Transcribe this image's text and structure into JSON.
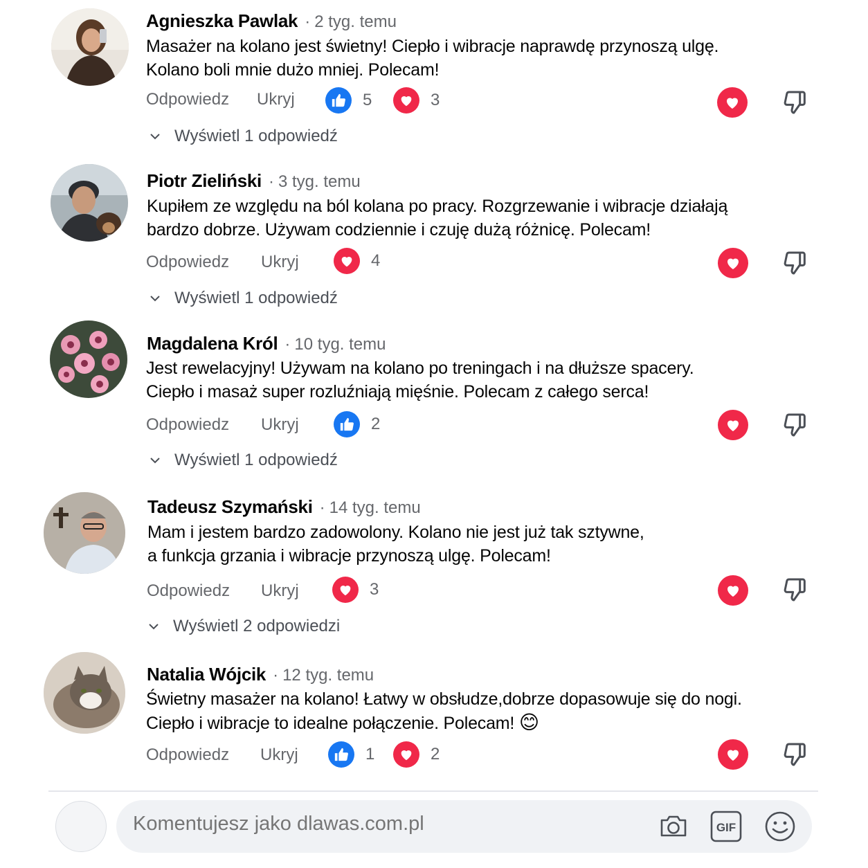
{
  "comments": [
    {
      "name": "Agnieszka Pawlak",
      "time": "2 tyg. temu",
      "line1": "Masażer na kolano jest świetny! Ciepło i wibracje naprawdę przynoszą ulgę.",
      "line2": "Kolano boli mnie dużo mniej. Polecam!",
      "reply_label": "Odpowiedz",
      "hide_label": "Ukryj",
      "like_count": "5",
      "love_count": "3",
      "view_replies": "Wyświetl 1 odpowiedź"
    },
    {
      "name": "Piotr Zieliński",
      "time": "3 tyg. temu",
      "line1": "Kupiłem ze względu na ból kolana po pracy. Rozgrzewanie i wibracje działają",
      "line2": "bardzo dobrze. Używam codziennie i czuję dużą różnicę. Polecam!",
      "reply_label": "Odpowiedz",
      "hide_label": "Ukryj",
      "love_count": "4",
      "view_replies": "Wyświetl 1 odpowiedź"
    },
    {
      "name": "Magdalena Król",
      "time": "10 tyg. temu",
      "line1": "Jest rewelacyjny! Używam na kolano po treningach i na dłuższe spacery.",
      "line2": "Ciepło i masaż super rozluźniają mięśnie. Polecam z całego serca!",
      "reply_label": "Odpowiedz",
      "hide_label": "Ukryj",
      "like_count": "2",
      "view_replies": "Wyświetl 1 odpowiedź"
    },
    {
      "name": "Tadeusz Szymański",
      "time": "14 tyg. temu",
      "line1": "Mam i jestem bardzo zadowolony. Kolano nie jest już tak sztywne,",
      "line2": "a funkcja grzania i wibracje przynoszą ulgę. Polecam!",
      "reply_label": "Odpowiedz",
      "hide_label": "Ukryj",
      "love_count": "3",
      "view_replies": "Wyświetl 2 odpowiedzi"
    },
    {
      "name": "Natalia Wójcik",
      "time": "12 tyg. temu",
      "line1": "Świetny masażer na kolano! Łatwy w obsłudze,dobrze dopasowuje się do nogi.",
      "line2": "Ciepło i wibracje to idealne połączenie. Polecam!",
      "emoji": "😊",
      "reply_label": "Odpowiedz",
      "hide_label": "Ukryj",
      "like_count": "1",
      "love_count": "2"
    }
  ],
  "composer": {
    "placeholder": "Komentujesz jako dlawas.com.pl",
    "icons": [
      "camera-icon",
      "gif-icon",
      "emoji-icon"
    ]
  },
  "colors": {
    "like": "#1877f2",
    "love": "#f02849",
    "muted_text": "#65676b"
  }
}
